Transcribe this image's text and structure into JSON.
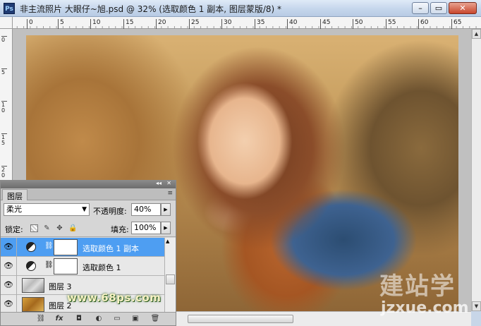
{
  "window": {
    "logo": "Ps",
    "title": "非主流照片 大眼仔~旭.psd @ 32% (选取颜色 1 副本, 图层蒙版/8) *",
    "minimize": "–",
    "restore": "▭",
    "close": "✕"
  },
  "ruler": {
    "h_ticks": [
      "0",
      "5",
      "10",
      "15",
      "20",
      "25",
      "30",
      "35",
      "40",
      "45",
      "50",
      "55",
      "60",
      "65"
    ],
    "v_ticks": [
      "0",
      "5",
      "10",
      "15",
      "20"
    ]
  },
  "layers_panel": {
    "tab_label": "图层",
    "menu_icon": "≡",
    "collapse_icon": "◂◂",
    "close_icon": "✕",
    "blend_mode": "柔光",
    "opacity_label": "不透明度:",
    "opacity_value": "40%",
    "lock_label": "锁定:",
    "fill_label": "填充:",
    "fill_value": "100%",
    "layers": [
      {
        "name": "选取颜色 1 副本",
        "selected": true
      },
      {
        "name": "选取颜色 1",
        "selected": false
      },
      {
        "name": "图层 3",
        "selected": false
      },
      {
        "name": "图层 2",
        "selected": false
      }
    ],
    "bottom_icons": [
      "⛓",
      "fx",
      "◘",
      "◐",
      "▭",
      "▣",
      "🗑"
    ]
  },
  "watermarks": {
    "site1": "www.68ps.com",
    "site2_cn": "建站学",
    "site2_en": "jzxue.com"
  }
}
